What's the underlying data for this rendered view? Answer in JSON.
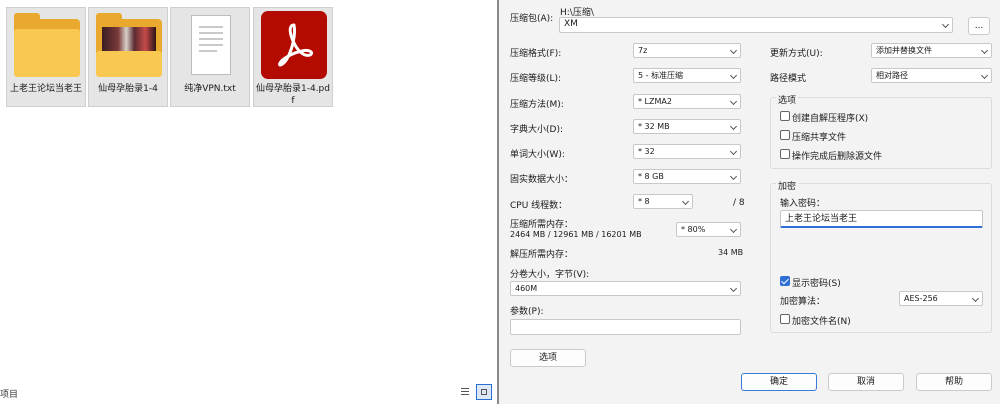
{
  "explorer": {
    "files": [
      {
        "label": "上老王论坛当老王",
        "icon": "folder-icon"
      },
      {
        "label": "仙母孕胎录1-4",
        "icon": "folder-photo-icon"
      },
      {
        "label": "纯净VPN.txt",
        "icon": "text-file-icon"
      },
      {
        "label": "仙母孕胎录1-4.pdf",
        "icon": "pdf-file-icon"
      }
    ],
    "status_text": "项目",
    "view_buttons": [
      "details-view-icon",
      "large-icons-view-icon"
    ]
  },
  "dialog": {
    "archive_label": "压缩包(A):",
    "archive_path": "H:\\压缩\\",
    "archive_name": "XM",
    "browse_label": "...",
    "format_label": "压缩格式(F):",
    "format_value": "7z",
    "level_label": "压缩等级(L):",
    "level_value": "5 - 标准压缩",
    "method_label": "压缩方法(M):",
    "method_value": "* LZMA2",
    "dict_label": "字典大小(D):",
    "dict_value": "* 32 MB",
    "word_label": "单词大小(W):",
    "word_value": "* 32",
    "solid_label": "固实数据大小：",
    "solid_value": "* 8 GB",
    "cpu_label": "CPU 线程数：",
    "cpu_value": "* 8",
    "cpu_max": "/ 8",
    "mem_comp_label": "压缩所需内存：",
    "mem_comp_detail": "2464 MB / 12961 MB / 16201 MB",
    "mem_comp_value": "* 80%",
    "mem_decomp_label": "解压所需内存：",
    "mem_decomp_value": "34 MB",
    "split_label": "分卷大小，字节(V):",
    "split_value": "460M",
    "params_label": "参数(P):",
    "params_value": "",
    "options_button": "选项",
    "update_label": "更新方式(U):",
    "update_value": "添加并替换文件",
    "path_label": "路径模式",
    "path_value": "相对路径",
    "options_group": "选项",
    "opt_sfx": "创建自解压程序(X)",
    "opt_shared": "压缩共享文件",
    "opt_delete": "操作完成后删除源文件",
    "encrypt_group": "加密",
    "password_label": "输入密码：",
    "password_value": "上老王论坛当老王",
    "show_password": "显示密码(S)",
    "enc_method_label": "加密算法：",
    "enc_method_value": "AES-256",
    "enc_names": "加密文件名(N)",
    "ok": "确定",
    "cancel": "取消",
    "help": "帮助"
  }
}
